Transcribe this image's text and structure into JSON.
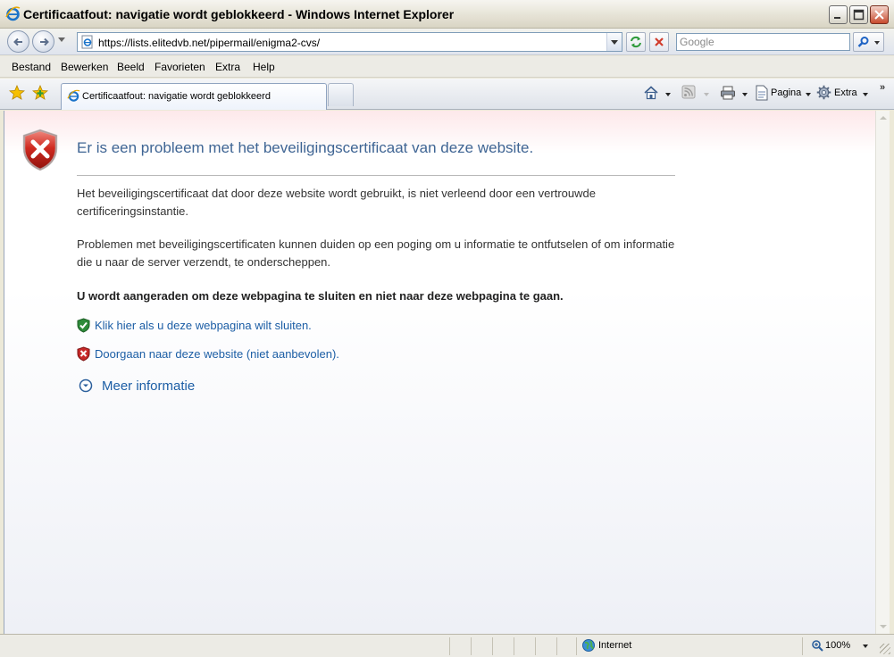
{
  "window": {
    "title": "Certificaatfout: navigatie wordt geblokkeerd - Windows Internet Explorer"
  },
  "address_bar": {
    "url": "https://lists.elitedvb.net/pipermail/enigma2-cvs/",
    "search_placeholder": "Google"
  },
  "menu": {
    "items": [
      "Bestand",
      "Bewerken",
      "Beeld",
      "Favorieten",
      "Extra",
      "Help"
    ]
  },
  "tabs": {
    "active_label": "Certificaatfout: navigatie wordt geblokkeerd"
  },
  "command_bar": {
    "page_label": "Pagina",
    "tools_label": "Extra"
  },
  "content": {
    "heading": "Er is een probleem met het beveiligingscertificaat van deze website.",
    "paragraph1": "Het beveiligingscertificaat dat door deze website wordt gebruikt, is niet verleend door een vertrouwde certificeringsinstantie.",
    "paragraph2": "Problemen met beveiligingscertificaten kunnen duiden op een poging om u informatie te ontfutselen of om informatie die u naar de server verzendt, te onderscheppen.",
    "advice": "U wordt aangeraden om deze webpagina te sluiten en niet naar deze webpagina te gaan.",
    "close_link": "Klik hier als u deze webpagina wilt sluiten.",
    "continue_link": "Doorgaan naar deze website (niet aanbevolen).",
    "more_info": "Meer informatie"
  },
  "status_bar": {
    "zone": "Internet",
    "zoom": "100%"
  },
  "colors": {
    "heading": "#3f6594",
    "link": "#1c5ea5",
    "shield_red": "#c62828",
    "shield_green": "#2e8b3a"
  }
}
